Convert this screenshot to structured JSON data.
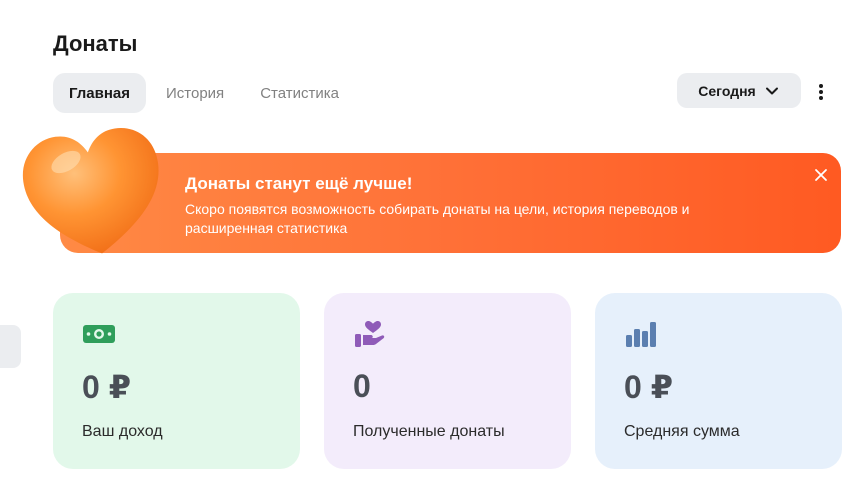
{
  "page": {
    "title": "Донаты"
  },
  "tabs": [
    {
      "label": "Главная",
      "active": true
    },
    {
      "label": "История",
      "active": false
    },
    {
      "label": "Статистика",
      "active": false
    }
  ],
  "period": {
    "selected": "Сегодня",
    "icon": "chevron-down-icon"
  },
  "more": {
    "icon": "more-vertical-icon"
  },
  "banner": {
    "title": "Донаты станут ещё лучше!",
    "text": "Скоро появятся возможность собирать донаты на цели, история переводов и расширенная статистика",
    "close_icon": "close-icon",
    "illustration": "heart-icon",
    "colors": {
      "start": "#ff8a45",
      "end": "#ff5a22",
      "heart": "#ff8a2a"
    }
  },
  "stats": [
    {
      "value": "0 ₽",
      "label": "Ваш доход",
      "icon": "money-icon",
      "bg": "#e2f8ea",
      "icon_color": "#2f9e5b"
    },
    {
      "value": "0",
      "label": "Полученные донаты",
      "icon": "hand-heart-icon",
      "bg": "#f3ecfb",
      "icon_color": "#8f5bb8"
    },
    {
      "value": "0 ₽",
      "label": "Средняя сумма",
      "icon": "bar-chart-icon",
      "bg": "#e6f0fb",
      "icon_color": "#5b7fb0"
    }
  ]
}
